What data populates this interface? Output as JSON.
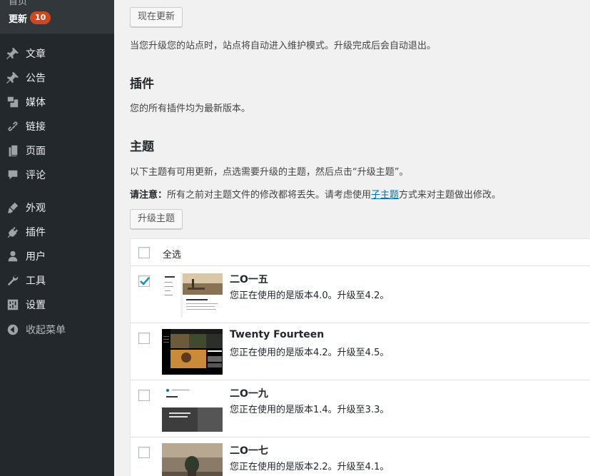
{
  "sidebar": {
    "prev_item": "首页",
    "updates_label": "更新",
    "updates_count": "10",
    "items": [
      {
        "label": "文章",
        "icon": "pin-icon"
      },
      {
        "label": "公告",
        "icon": "pin-icon"
      },
      {
        "label": "媒体",
        "icon": "media-icon"
      },
      {
        "label": "链接",
        "icon": "link-icon"
      },
      {
        "label": "页面",
        "icon": "page-icon"
      },
      {
        "label": "评论",
        "icon": "comment-icon"
      },
      {
        "label": "外观",
        "icon": "brush-icon"
      },
      {
        "label": "插件",
        "icon": "plugin-icon"
      },
      {
        "label": "用户",
        "icon": "user-icon"
      },
      {
        "label": "工具",
        "icon": "wrench-icon"
      },
      {
        "label": "设置",
        "icon": "settings-icon"
      }
    ],
    "collapse_label": "收起菜单"
  },
  "core": {
    "update_now_button": "现在更新",
    "maintenance_note": "当您升级您的站点时，站点将自动进入维护模式。升级完成后会自动退出。"
  },
  "plugins": {
    "heading": "插件",
    "status": "您的所有插件均为最新版本。"
  },
  "themes": {
    "heading": "主题",
    "intro": "以下主题有可用更新，点选需要升级的主题，然后点击“升级主题”。",
    "notice_strong": "请注意：",
    "notice_text_before": "所有之前对主题文件的修改都将丢失。请考虑使用",
    "notice_link": "子主题",
    "notice_text_after": "方式来对主题做出修改。",
    "upgrade_button": "升级主题",
    "select_all": "全选",
    "list": [
      {
        "name": "二O一五",
        "version_text": "您正在使用的是版本4.0。升级至4.2。",
        "checked": true
      },
      {
        "name": "Twenty Fourteen",
        "version_text": "您正在使用的是版本4.2。升级至4.5。",
        "checked": false
      },
      {
        "name": "二O一九",
        "version_text": "您正在使用的是版本1.4。升级至3.3。",
        "checked": false
      },
      {
        "name": "二O一七",
        "version_text": "您正在使用的是版本2.2。升级至4.1。",
        "checked": false
      }
    ]
  },
  "colors": {
    "sidebar_bg": "#23282d",
    "badge": "#ca4a1f",
    "link": "#0073aa",
    "check": "#1e8cbe"
  }
}
